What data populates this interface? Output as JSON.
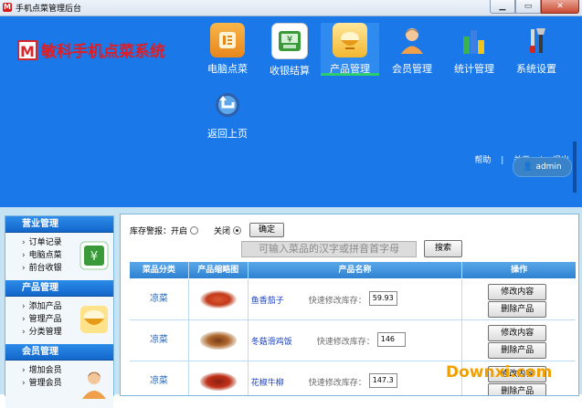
{
  "window": {
    "title": "手机点菜管理后台",
    "icon_letter": "M",
    "controls": [
      "minimize-icon",
      "maximize-icon",
      "close-icon"
    ]
  },
  "brand": {
    "mark": "M",
    "name": "敏科手机点菜系统",
    "color": "#e21d22"
  },
  "nav": [
    {
      "label": "电脑点菜",
      "icon": "menu-card-icon",
      "active": false
    },
    {
      "label": "收银结算",
      "icon": "cash-register-icon",
      "active": false
    },
    {
      "label": "产品管理",
      "icon": "food-bowl-icon",
      "active": true
    },
    {
      "label": "会员管理",
      "icon": "member-icon",
      "active": false
    },
    {
      "label": "统计管理",
      "icon": "bar-chart-icon",
      "active": false
    },
    {
      "label": "系统设置",
      "icon": "tools-icon",
      "active": false
    },
    {
      "label": "返回上页",
      "icon": "back-arrow-icon",
      "active": false
    }
  ],
  "top_links": {
    "help": "帮助",
    "about": "关于",
    "exit": "退出"
  },
  "user": {
    "name": "admin"
  },
  "sidebar": {
    "sections": [
      {
        "title": "营业管理",
        "items": [
          "订单记录",
          "电脑点菜",
          "前台收银"
        ],
        "icon": "cash-register-icon"
      },
      {
        "title": "产品管理",
        "items": [
          "添加产品",
          "管理产品",
          "分类管理"
        ],
        "icon": "food-bowl-icon"
      },
      {
        "title": "会员管理",
        "items": [
          "增加会员",
          "管理会员"
        ],
        "icon": "member-icon"
      }
    ]
  },
  "stock_alert": {
    "label": "库存警报：开启",
    "off_label": "关闭",
    "selected": "off",
    "confirm": "确定"
  },
  "search": {
    "placeholder": "可输入菜品的汉字或拼音首字母",
    "button": "搜索"
  },
  "table": {
    "headers": [
      "菜品分类",
      "产品缩略图",
      "产品名称",
      "操作"
    ],
    "rows": [
      {
        "category": "凉菜",
        "name": "鱼香茄子",
        "quick_label": "快速修改库存：",
        "stock": "59.93",
        "edit": "修改内容",
        "delete": "删除产品"
      },
      {
        "category": "凉菜",
        "name": "冬菇滑鸡饭",
        "quick_label": "快速修改库存：",
        "stock": "146",
        "edit": "修改内容",
        "delete": "删除产品"
      },
      {
        "category": "凉菜",
        "name": "花椒牛柳",
        "quick_label": "快速修改库存：",
        "stock": "147.3",
        "edit": "修改内容",
        "delete": "删除产品"
      }
    ]
  },
  "watermark": "Downxi.com",
  "colors": {
    "header_bg": "#1a78e9",
    "strip_bg": "#c6e3f4",
    "active_underline": "#2ecc71",
    "watermark": "#f0a000"
  }
}
